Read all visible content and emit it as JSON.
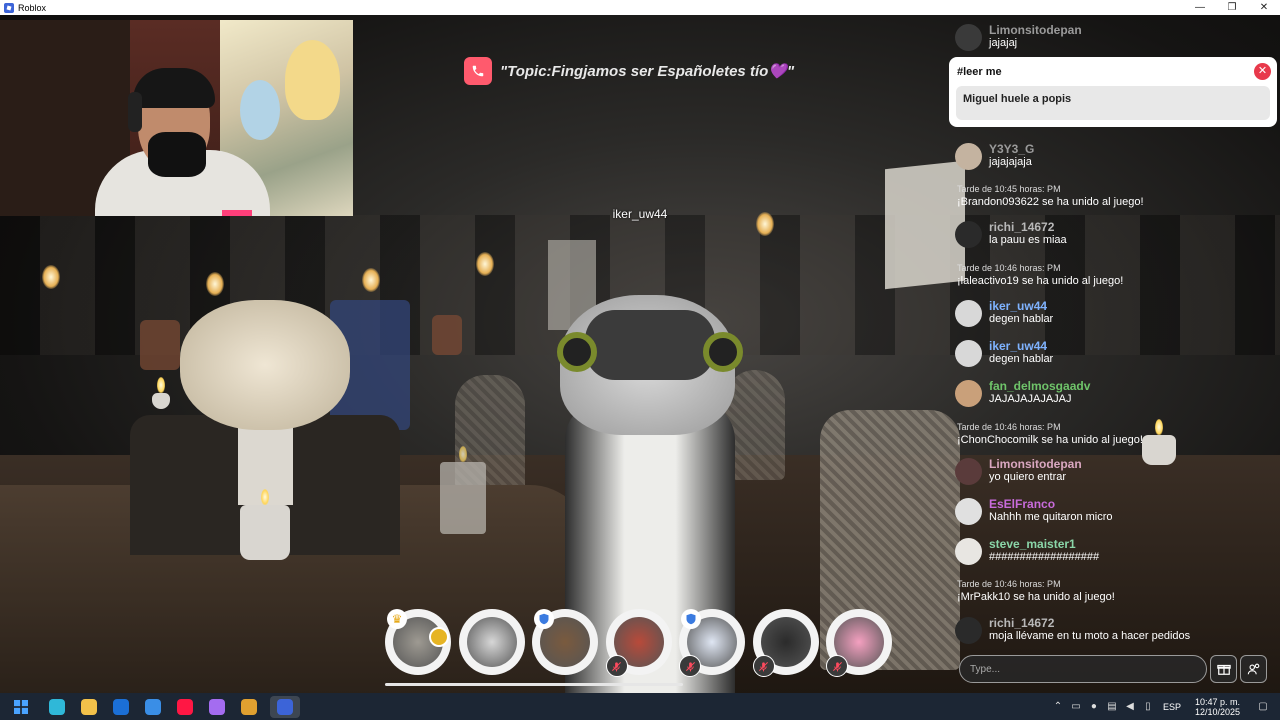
{
  "window": {
    "title": "Roblox",
    "controls": [
      "minimize",
      "restore",
      "close"
    ]
  },
  "topic": {
    "text": "\"Topic:Fingjamos ser Españoletes tío💜\""
  },
  "player_nametag": "iker_uw44",
  "pinned": {
    "title": "#leer me",
    "message": "Miguel huele a popis"
  },
  "chat": {
    "messages": [
      {
        "kind": "user",
        "name": "Limonsitodepan",
        "text": "jajajaj",
        "name_color": "#9a9a9a",
        "avatar": "#3a3a3a"
      },
      {
        "kind": "user",
        "name": "Y3Y3_G",
        "text": "jajajajaja",
        "name_color": "#9a9a9a",
        "avatar": "#c4b3a0"
      },
      {
        "kind": "system",
        "time": "Tarde de 10:45 horas: PM",
        "text": "¡Brandon093622 se ha unido al juego!"
      },
      {
        "kind": "user",
        "name": "richi_14672",
        "text": "la pauu es miaa",
        "name_color": "#b8b8b8",
        "avatar": "#2a2a2a"
      },
      {
        "kind": "system",
        "time": "Tarde de 10:46 horas: PM",
        "text": "¡laleactivo19 se ha unido al juego!"
      },
      {
        "kind": "user",
        "name": "iker_uw44",
        "text": "degen hablar",
        "name_color": "#7fb3ff",
        "avatar": "#d8d8d8"
      },
      {
        "kind": "user",
        "name": "iker_uw44",
        "text": "degen hablar",
        "name_color": "#7fb3ff",
        "avatar": "#d8d8d8"
      },
      {
        "kind": "user",
        "name": "fan_delmosgaadv",
        "text": "JAJAJAJAJAJAJ",
        "name_color": "#6fc46a",
        "avatar": "#c9a07a"
      },
      {
        "kind": "system",
        "time": "Tarde de 10:46 horas: PM",
        "text": "¡ChonChocomilk se ha unido al juego!"
      },
      {
        "kind": "user",
        "name": "Limonsitodepan",
        "text": "yo quiero entrar",
        "name_color": "#d9a7c0",
        "avatar": "#5a3b3b"
      },
      {
        "kind": "user",
        "name": "EsElFranco",
        "text": "Nahhh me quitaron micro",
        "name_color": "#c86bdb",
        "avatar": "#e0e0e0"
      },
      {
        "kind": "user",
        "name": "steve_maister1",
        "text": "##################",
        "name_color": "#8ad6a8",
        "avatar": "#e8e6e2"
      },
      {
        "kind": "system",
        "time": "Tarde de 10:46 horas: PM",
        "text": "¡MrPakk10 se ha unido al juego!"
      },
      {
        "kind": "user",
        "name": "richi_14672",
        "text": "moja llévame en tu moto a hacer pedidos",
        "name_color": "#b8b8b8",
        "avatar": "#2a2a2a"
      }
    ],
    "input_placeholder": "Type..."
  },
  "voice_participants": [
    {
      "name": "participant-1",
      "color": "#9e9a92",
      "muted": false,
      "crown": true,
      "badge": true,
      "shield": false
    },
    {
      "name": "participant-2",
      "color": "#d7d7d7",
      "muted": false,
      "crown": false,
      "badge": false,
      "shield": false
    },
    {
      "name": "participant-3",
      "color": "#7a5a3e",
      "muted": false,
      "crown": false,
      "badge": false,
      "shield": true
    },
    {
      "name": "participant-4",
      "color": "#b84a3a",
      "muted": true,
      "crown": false,
      "badge": false,
      "shield": false
    },
    {
      "name": "participant-5",
      "color": "#dfe6f3",
      "muted": true,
      "crown": false,
      "badge": false,
      "shield": true
    },
    {
      "name": "participant-6",
      "color": "#2b2b2b",
      "muted": true,
      "crown": false,
      "badge": false,
      "shield": false
    },
    {
      "name": "participant-7",
      "color": "#f4a0c0",
      "muted": true,
      "crown": false,
      "badge": false,
      "shield": false
    }
  ],
  "taskbar": {
    "apps": [
      {
        "name": "windows-start-icon",
        "color": "#4aa3ff"
      },
      {
        "name": "edge-icon",
        "color": "#2fb8d8"
      },
      {
        "name": "file-explorer-icon",
        "color": "#f2c14a"
      },
      {
        "name": "outlook-icon",
        "color": "#1b6fd6"
      },
      {
        "name": "microsoft-store-icon",
        "color": "#3a8ee6"
      },
      {
        "name": "opera-gx-icon",
        "color": "#ff1744"
      },
      {
        "name": "copilot-icon",
        "color": "#a46cf0"
      },
      {
        "name": "steam-like-icon",
        "color": "#e0a030"
      },
      {
        "name": "roblox-icon",
        "color": "#3c64d8"
      }
    ],
    "language": "ESP",
    "time": "10:47 p. m.",
    "date": "12/10/2025"
  }
}
